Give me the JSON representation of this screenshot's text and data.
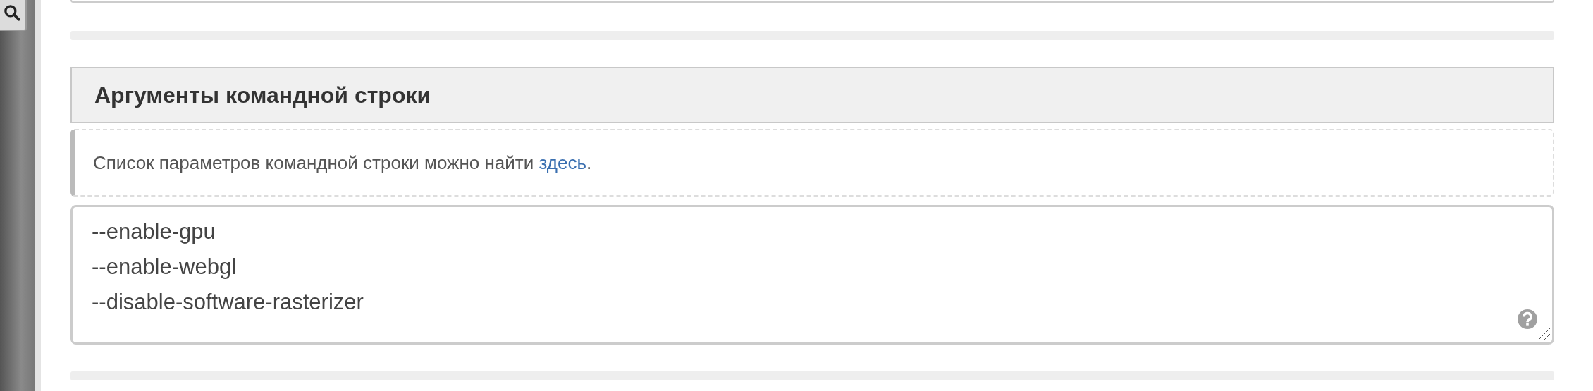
{
  "section": {
    "title": "Аргументы командной строки"
  },
  "info": {
    "text": "Список параметров командной строки можно найти ",
    "link": "здесь",
    "tail": "."
  },
  "arguments": {
    "value": [
      "--enable-gpu",
      "--enable-webgl",
      "--disable-software-rasterizer"
    ]
  }
}
